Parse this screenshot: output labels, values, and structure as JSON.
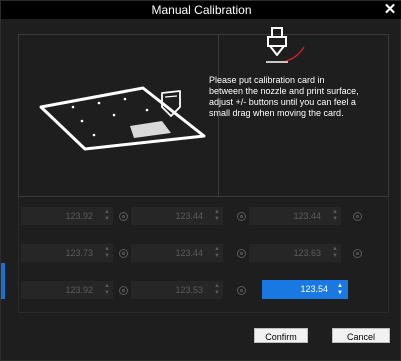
{
  "window": {
    "title": "Manual Calibration",
    "close_glyph": "✕"
  },
  "instructions": "Please put calibration card in between the nozzle and print surface, adjust +/- buttons until you can feel a small drag when moving the card.",
  "grid": {
    "rows": [
      [
        "123.92",
        "123.44",
        "123.44"
      ],
      [
        "123.73",
        "123.44",
        "123.63"
      ],
      [
        "123.92",
        "123.53",
        "123.54"
      ]
    ],
    "active_cell": "row3-col3"
  },
  "buttons": {
    "confirm": "Confirm",
    "cancel": "Cancel"
  },
  "colors": {
    "accent": "#1a78e3",
    "highlight_red": "#e0202a"
  }
}
